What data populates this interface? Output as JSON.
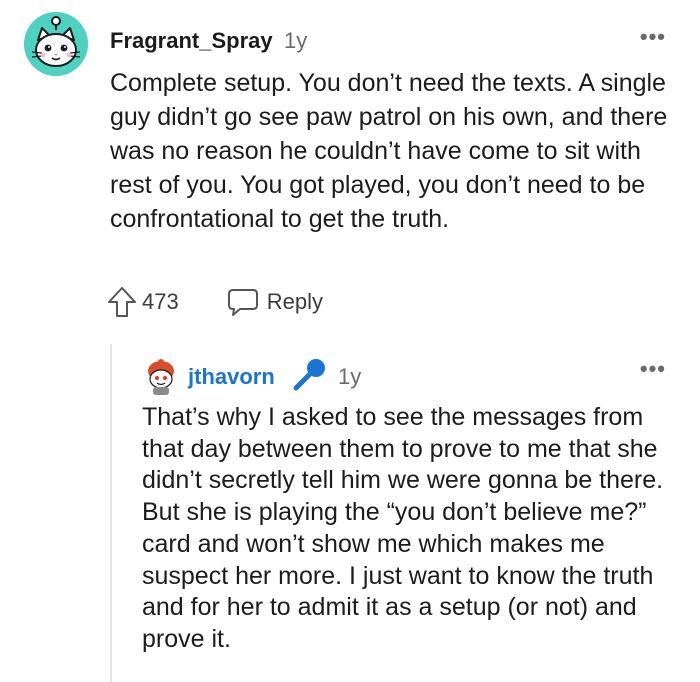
{
  "comment": {
    "username": "Fragrant_Spray",
    "age": "1y",
    "body": "Complete setup. You don’t need the texts. A single guy didn’t go see paw patrol on his own, and there was no reason he couldn’t have come to sit with rest of you. You got played, you don’t need to be confrontational to get the truth.",
    "upvotes": "473",
    "reply_label": "Reply",
    "more_label": "•••"
  },
  "reply": {
    "username": "jthavorn",
    "age": "1y",
    "body": "That’s why I asked to see the messages from that day between them to prove to me that she didn’t secretly tell him we were gonna be there. But she is playing the “you don’t believe me?” card and won’t show me which makes me suspect her more. I just want to know the truth and for her to admit it as a setup (or not) and prove it.",
    "more_label": "•••"
  },
  "colors": {
    "username_reply": "#1a74d2",
    "avatar_main_bg": "#4fd1c1",
    "mic_icon": "#1a74d2"
  },
  "icons": [
    "snoo-cat-avatar",
    "upvote-arrow-icon",
    "comment-bubble-icon",
    "more-icon",
    "snoo-avatar",
    "microphone-icon"
  ]
}
